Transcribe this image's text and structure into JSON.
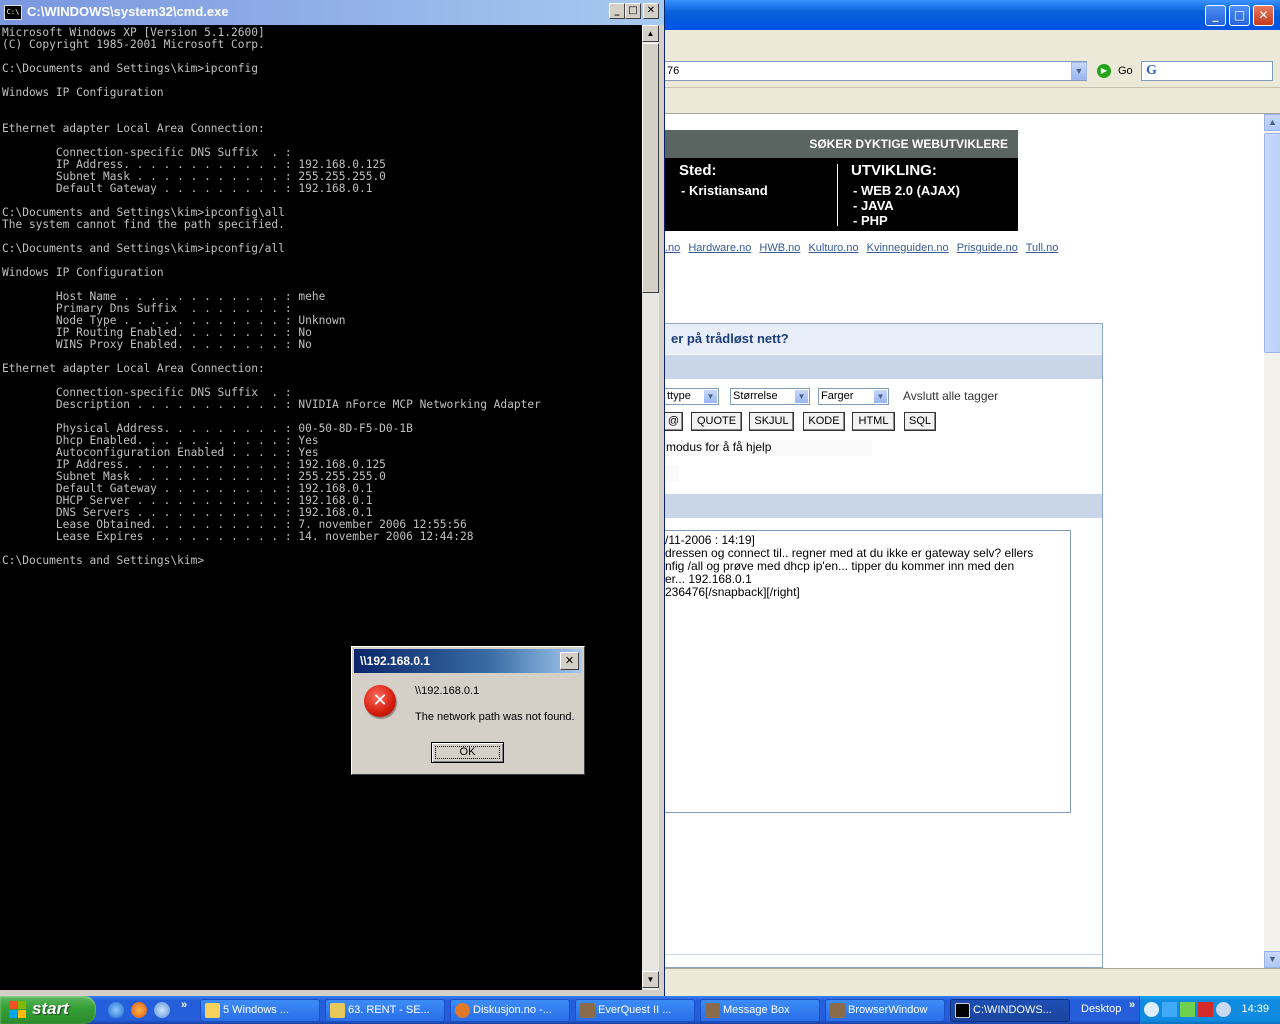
{
  "cmd": {
    "title": "C:\\WINDOWS\\system32\\cmd.exe",
    "icon_label": "C:\\",
    "lines": [
      "Microsoft Windows XP [Version 5.1.2600]",
      "(C) Copyright 1985-2001 Microsoft Corp.",
      "",
      "C:\\Documents and Settings\\kim>ipconfig",
      "",
      "Windows IP Configuration",
      "",
      "",
      "Ethernet adapter Local Area Connection:",
      "",
      "        Connection-specific DNS Suffix  . :",
      "        IP Address. . . . . . . . . . . . : 192.168.0.125",
      "        Subnet Mask . . . . . . . . . . . : 255.255.255.0",
      "        Default Gateway . . . . . . . . . : 192.168.0.1",
      "",
      "C:\\Documents and Settings\\kim>ipconfig\\all",
      "The system cannot find the path specified.",
      "",
      "C:\\Documents and Settings\\kim>ipconfig/all",
      "",
      "Windows IP Configuration",
      "",
      "        Host Name . . . . . . . . . . . . : mehe",
      "        Primary Dns Suffix  . . . . . . . :",
      "        Node Type . . . . . . . . . . . . : Unknown",
      "        IP Routing Enabled. . . . . . . . : No",
      "        WINS Proxy Enabled. . . . . . . . : No",
      "",
      "Ethernet adapter Local Area Connection:",
      "",
      "        Connection-specific DNS Suffix  . :",
      "        Description . . . . . . . . . . . : NVIDIA nForce MCP Networking Adapter",
      "",
      "        Physical Address. . . . . . . . . : 00-50-8D-F5-D0-1B",
      "        Dhcp Enabled. . . . . . . . . . . : Yes",
      "        Autoconfiguration Enabled . . . . : Yes",
      "        IP Address. . . . . . . . . . . . : 192.168.0.125",
      "        Subnet Mask . . . . . . . . . . . : 255.255.255.0",
      "        Default Gateway . . . . . . . . . : 192.168.0.1",
      "        DHCP Server . . . . . . . . . . . : 192.168.0.1",
      "        DNS Servers . . . . . . . . . . . : 192.168.0.1",
      "        Lease Obtained. . . . . . . . . . : 7. november 2006 12:55:56",
      "        Lease Expires . . . . . . . . . . : 14. november 2006 12:44:28",
      "",
      "C:\\Documents and Settings\\kim>"
    ],
    "buttons": {
      "minimize": "_",
      "maximize": "□",
      "close": "✕"
    }
  },
  "dialog": {
    "title": "\\\\192.168.0.1",
    "path": "\\\\192.168.0.1",
    "message": "The network path was not found.",
    "ok_label": "OK",
    "close_label": "✕",
    "icon_glyph": "✕"
  },
  "browser": {
    "url_fragment": "76",
    "go_label": "Go",
    "google_glyph": "G",
    "ad": {
      "heading": "SØKER DYKTIGE WEBUTVIKLERE",
      "sted": "Sted:",
      "city": "- Kristiansand",
      "utvikling": "UTVIKLING:",
      "items": [
        "- WEB 2.0 (AJAX)",
        "- JAVA",
        "- PHP"
      ]
    },
    "site_links": [
      ".no",
      "Hardware.no",
      "HWB.no",
      "Kulturo.no",
      "Kvinneguiden.no",
      "Prisguide.no",
      "Tull.no"
    ],
    "thread_title": "er på trådløst nett?",
    "selects": [
      "ttype",
      "Størrelse",
      "Farger"
    ],
    "close_tags": "Avslutt alle tagger",
    "tag_buttons": [
      "@",
      "QUOTE",
      "SKJUL",
      "KODE",
      "HTML",
      "SQL"
    ],
    "help_text": "modus for å få hjelp",
    "message_lines": [
      "/11-2006 : 14:19]",
      "dressen og connect til.. regner med at du ikke er gateway selv? ellers",
      "nfig /all og prøve med dhcp ip'en... tipper du kommer inn med den",
      "er... 192.168.0.1",
      "236476[/snapback][/right]"
    ]
  },
  "taskbar": {
    "start_label": "start",
    "tasks": [
      "5 Windows ...",
      "63. RENT - SE...",
      "Diskusjon.no -...",
      "EverQuest II ...",
      "Message Box",
      "BrowserWindow",
      "C:\\WINDOWS..."
    ],
    "desktop_label": "Desktop",
    "clock": "14:39"
  },
  "colors": {
    "xp_blue": "#0054e3",
    "console_bg": "#000000",
    "console_fg": "#c0c0c0",
    "taskbar_blue": "#245edb",
    "start_green": "#37a037",
    "error_red": "#d41c0c"
  }
}
